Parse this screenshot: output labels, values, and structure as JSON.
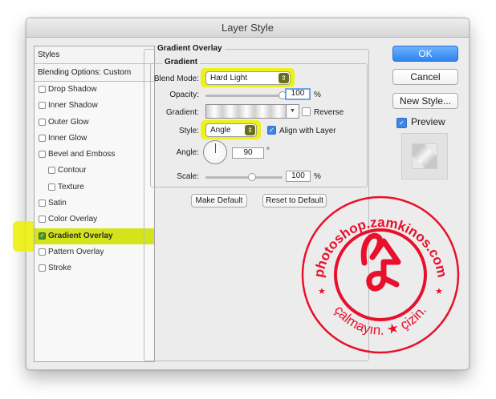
{
  "window": {
    "title": "Layer Style"
  },
  "styles_panel": {
    "header": "Styles",
    "blending_options": "Blending Options: Custom",
    "effects": [
      {
        "label": "Drop Shadow",
        "checked": false,
        "sub": false
      },
      {
        "label": "Inner Shadow",
        "checked": false,
        "sub": false
      },
      {
        "label": "Outer Glow",
        "checked": false,
        "sub": false
      },
      {
        "label": "Inner Glow",
        "checked": false,
        "sub": false
      },
      {
        "label": "Bevel and Emboss",
        "checked": false,
        "sub": false
      },
      {
        "label": "Contour",
        "checked": false,
        "sub": true
      },
      {
        "label": "Texture",
        "checked": false,
        "sub": true
      },
      {
        "label": "Satin",
        "checked": false,
        "sub": false
      },
      {
        "label": "Color Overlay",
        "checked": false,
        "sub": false
      },
      {
        "label": "Gradient Overlay",
        "checked": true,
        "sub": false,
        "active": true
      },
      {
        "label": "Pattern Overlay",
        "checked": false,
        "sub": false
      },
      {
        "label": "Stroke",
        "checked": false,
        "sub": false
      }
    ]
  },
  "gradient_overlay": {
    "section_title": "Gradient Overlay",
    "group_title": "Gradient",
    "blend_mode_label": "Blend Mode:",
    "blend_mode_value": "Hard Light",
    "opacity_label": "Opacity:",
    "opacity_value": "100",
    "opacity_unit": "%",
    "opacity_slider_fraction": 1.0,
    "gradient_label": "Gradient:",
    "reverse_label": "Reverse",
    "reverse_checked": false,
    "style_label": "Style:",
    "style_value": "Angle",
    "align_label": "Align with Layer",
    "align_checked": true,
    "angle_label": "Angle:",
    "angle_value": "90",
    "angle_unit": "°",
    "scale_label": "Scale:",
    "scale_value": "100",
    "scale_unit": "%",
    "scale_slider_fraction": 0.6,
    "make_default": "Make Default",
    "reset_default": "Reset to Default"
  },
  "actions": {
    "ok": "OK",
    "cancel": "Cancel",
    "new_style": "New Style...",
    "preview_label": "Preview",
    "preview_checked": true
  },
  "watermark": {
    "top_text": "photoshop.zamkinos.com",
    "bottom_text": "çalmayın. ★ çizin.",
    "color": "#e8102a"
  },
  "colors": {
    "highlight": "#edf200",
    "ok_blue": "#2f83ec",
    "checkbox_blue": "#3d86e6"
  }
}
